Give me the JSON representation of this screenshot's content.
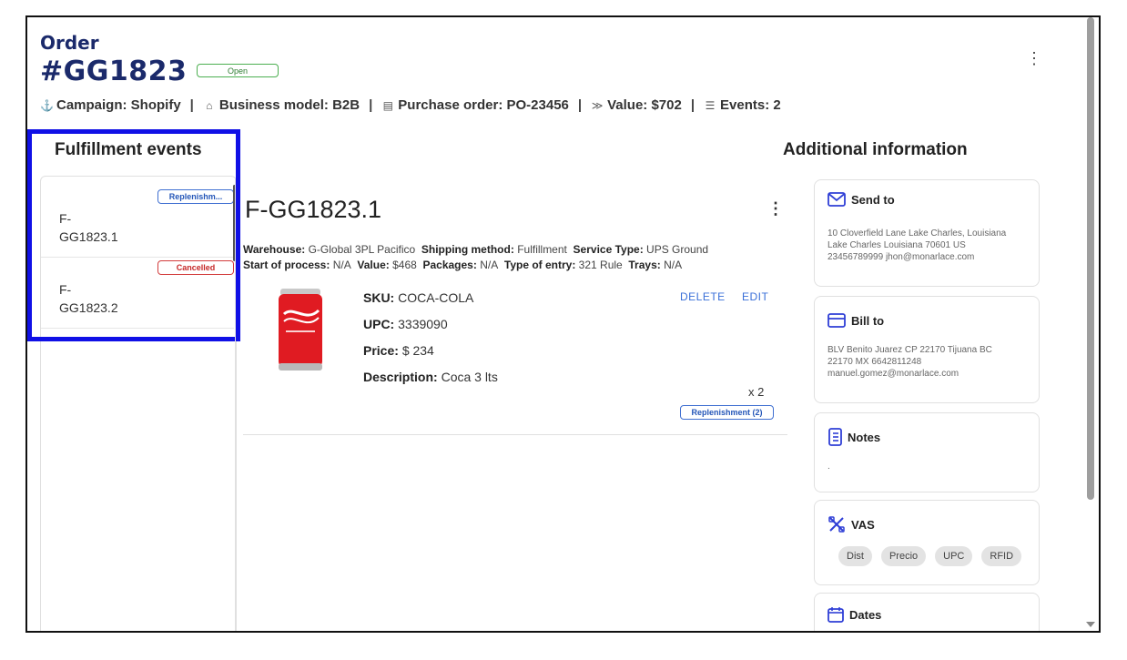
{
  "header": {
    "order_label": "Order",
    "order_id": "#GG1823",
    "status": "Open",
    "meta": [
      {
        "icon": "anchor-icon",
        "glyph": "⚓",
        "text": "Campaign: Shopify"
      },
      {
        "icon": "building-icon",
        "glyph": "⌂",
        "text": "Business model: B2B"
      },
      {
        "icon": "document-icon",
        "glyph": "▤",
        "text": "Purchase order: PO-23456"
      },
      {
        "icon": "value-icon",
        "glyph": "≫",
        "text": "Value: $702"
      },
      {
        "icon": "list-icon",
        "glyph": "☰",
        "text": "Events: 2"
      }
    ]
  },
  "sections": {
    "fulfillment_events": "Fulfillment events",
    "additional_information": "Additional information"
  },
  "events": [
    {
      "name": "F-GG1823.1",
      "badge": "Replenishm...",
      "badge_color": "#2456b8"
    },
    {
      "name": "F-GG1823.2",
      "badge": "Cancelled",
      "badge_color": "#c62828"
    }
  ],
  "fulfillment": {
    "id": "F-GG1823.1",
    "line1": [
      {
        "label": "Warehouse:",
        "value": "G-Global 3PL Pacifico"
      },
      {
        "label": "Shipping method:",
        "value": "Fulfillment"
      },
      {
        "label": "Service Type:",
        "value": "UPS Ground"
      }
    ],
    "line2": [
      {
        "label": "Start of process:",
        "value": "N/A"
      },
      {
        "label": "Value:",
        "value": "$468"
      },
      {
        "label": "Packages:",
        "value": "N/A"
      },
      {
        "label": "Type of entry:",
        "value": "321 Rule"
      },
      {
        "label": "Trays:",
        "value": "N/A"
      }
    ],
    "product": {
      "sku_label": "SKU:",
      "sku": "COCA-COLA",
      "upc_label": "UPC:",
      "upc": "3339090",
      "price_label": "Price:",
      "price": "$ 234",
      "desc_label": "Description:",
      "description": "Coca 3 lts",
      "quantity": "x 2",
      "badge": "Replenishment (2)"
    },
    "actions": {
      "delete": "DELETE",
      "edit": "EDIT"
    }
  },
  "additional": {
    "send_to": {
      "title": "Send to",
      "lines": [
        "10 Cloverfield Lane Lake Charles, Louisiana",
        "Lake Charles Louisiana 70601 US",
        "23456789999 jhon@monarlace.com"
      ]
    },
    "bill_to": {
      "title": "Bill to",
      "lines": [
        "BLV Benito Juarez CP 22170 Tijuana BC",
        "22170 MX 6642811248",
        "manuel.gomez@monarlace.com"
      ]
    },
    "notes": {
      "title": "Notes",
      "body": "."
    },
    "vas": {
      "title": "VAS",
      "chips": [
        "Dist",
        "Precio",
        "UPC",
        "RFID"
      ]
    },
    "dates": {
      "title": "Dates"
    }
  },
  "colors": {
    "brand_navy": "#1b2a6b",
    "accent_blue": "#1010e6",
    "status_open": "#2e7d32",
    "status_cancelled": "#c62828"
  }
}
